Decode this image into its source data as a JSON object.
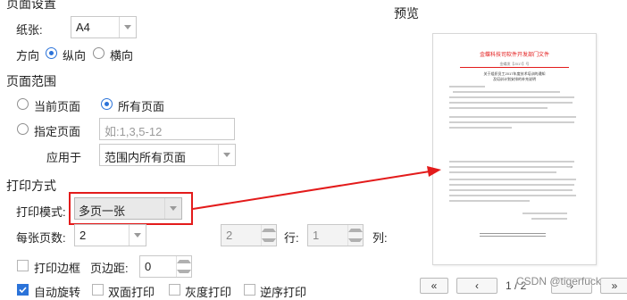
{
  "page_setup": {
    "title": "页面设置",
    "paper_label": "纸张:",
    "paper_value": "A4",
    "orientation_label": "方向",
    "portrait_label": "纵向",
    "landscape_label": "横向",
    "orientation_selected": "portrait"
  },
  "preview": {
    "title": "预览",
    "doc_header": "金蝶科技司软件开发部门文件",
    "doc_subtitle": "金蝶发【2017】号",
    "doc_heading_line1": "关于组织员工2017年度技术培训的通知",
    "doc_heading_line2": "及培训计划安排的补充说明",
    "page_indicator": "1 / 2",
    "watermark": "CSDN @tigerfuck"
  },
  "page_range": {
    "title": "页面范围",
    "current_page_label": "当前页面",
    "all_pages_label": "所有页面",
    "specified_pages_label": "指定页面",
    "specified_placeholder": "如:1,3,5-12",
    "apply_to_label": "应用于",
    "apply_to_value": "范围内所有页面",
    "selected": "all"
  },
  "print_method": {
    "title": "打印方式",
    "mode_label": "打印模式:",
    "mode_value": "多页一张",
    "pages_per_sheet_label": "每张页数:",
    "pages_per_sheet_value": "2",
    "rows_value": "2",
    "rows_label": "行:",
    "cols_value": "1",
    "cols_label": "列:",
    "print_border_label": "打印边框",
    "page_margin_label": "页边距:",
    "page_margin_value": "0",
    "options": [
      {
        "label": "自动旋转",
        "checked": true
      },
      {
        "label": "双面打印",
        "checked": false
      },
      {
        "label": "灰度打印",
        "checked": false
      },
      {
        "label": "逆序打印",
        "checked": false
      }
    ]
  },
  "nav": {
    "first_label": "«",
    "prev_label": "‹",
    "next_label": "›",
    "last_label": "»"
  },
  "colors": {
    "accent": "#2b73d9",
    "highlight": "#e31b1b"
  }
}
